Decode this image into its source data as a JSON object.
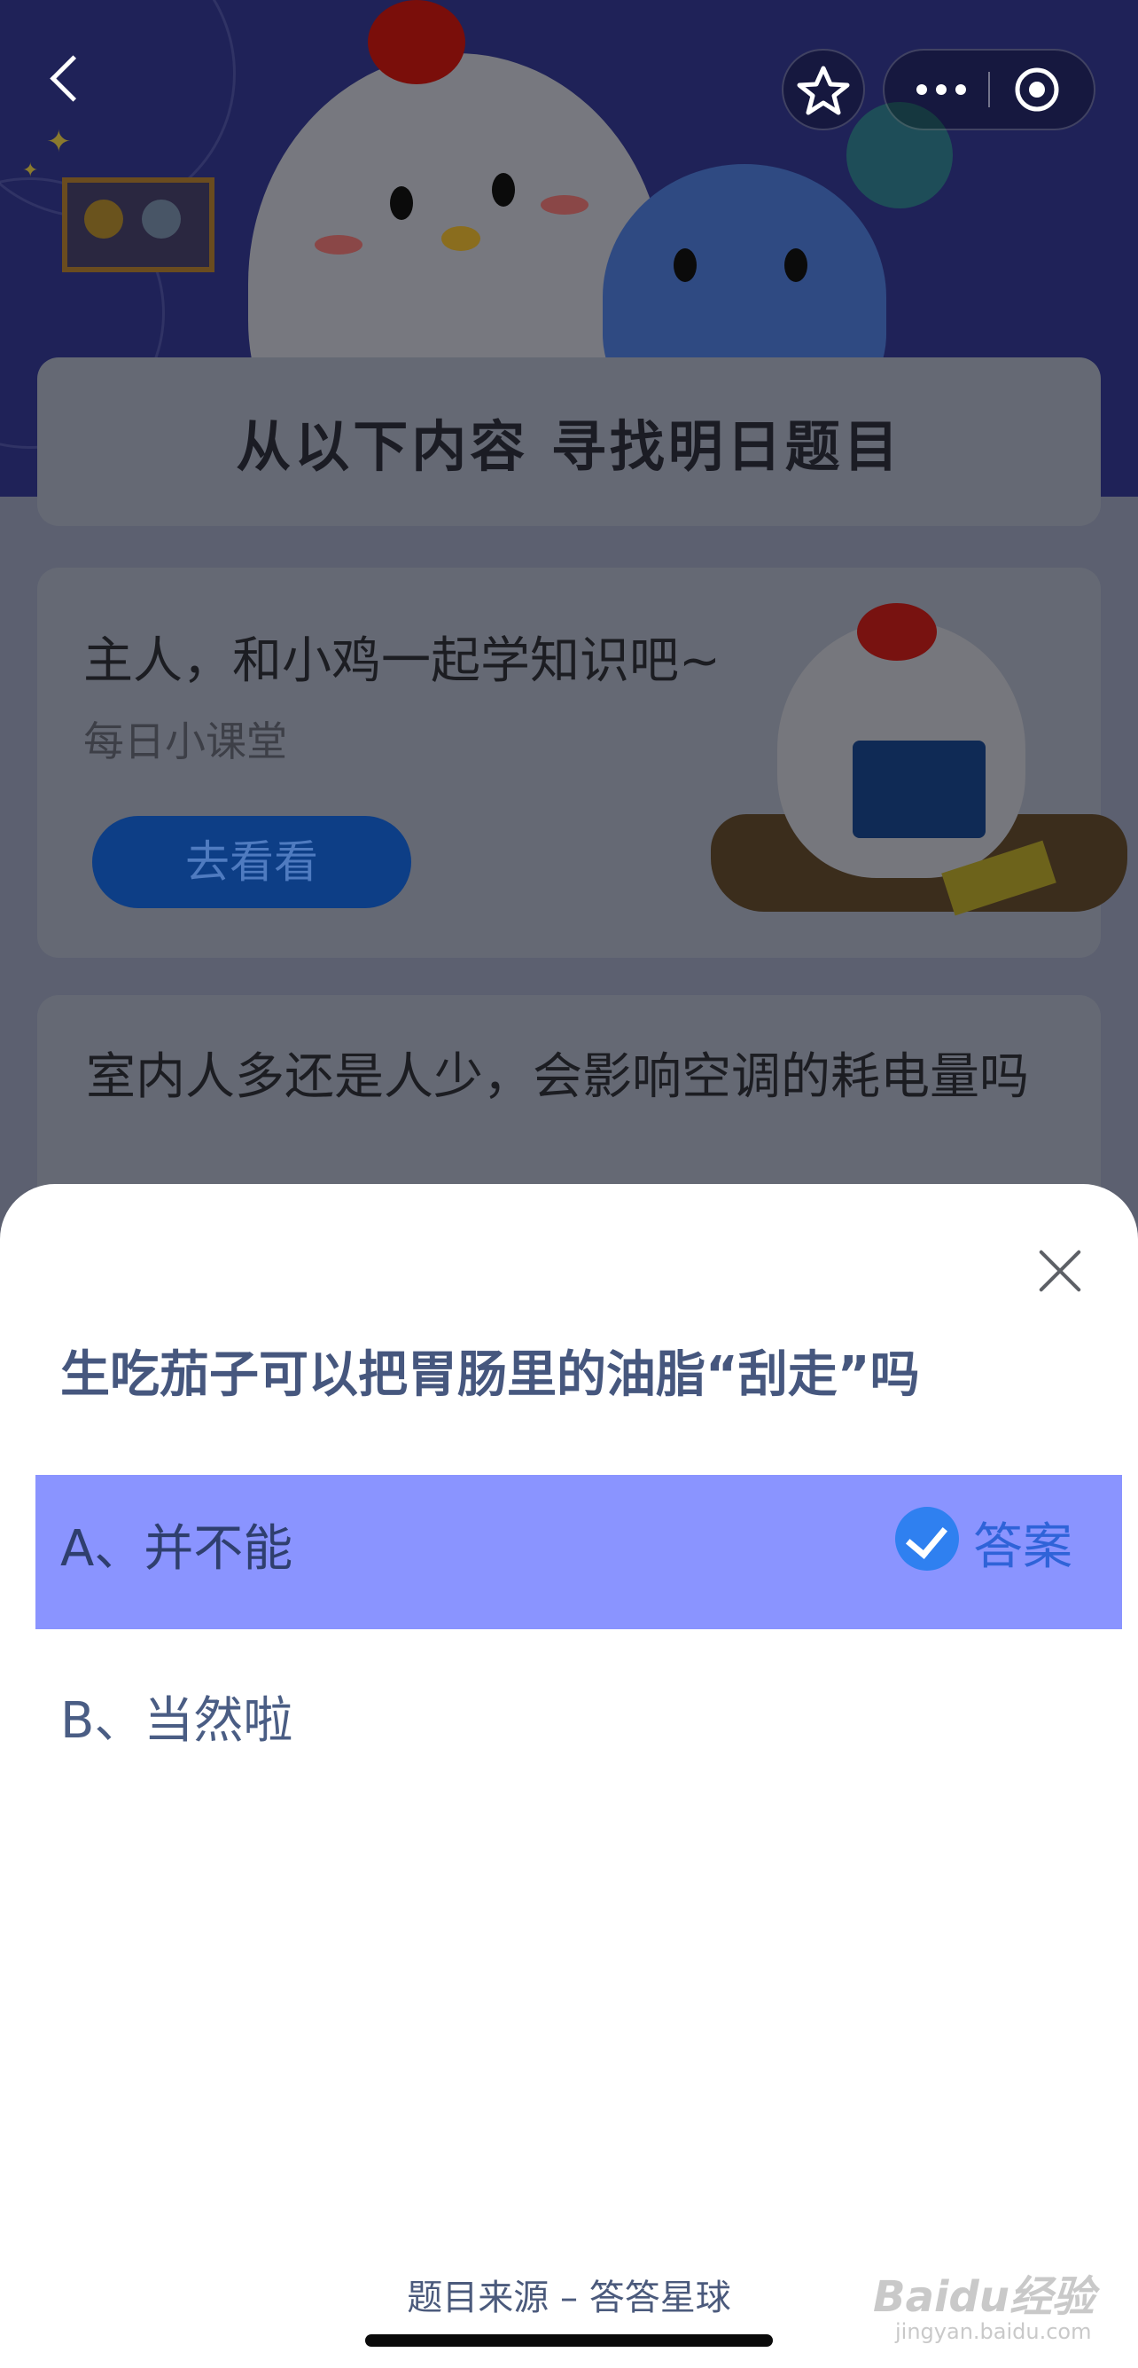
{
  "banner": {
    "title": "从以下内容 寻找明日题目"
  },
  "lesson_card": {
    "title": "主人，和小鸡一起学知识吧~",
    "subtitle": "每日小课堂",
    "button_label": "去看看"
  },
  "question_card": {
    "text": "室内人多还是人少，会影响空调的耗电量吗"
  },
  "sheet": {
    "question": "生吃茄子可以把胃肠里的油脂“刮走”吗",
    "options": [
      {
        "label": "A、并不能",
        "is_answer": true,
        "answer_tag": "答案"
      },
      {
        "label": "B、当然啦",
        "is_answer": false
      }
    ],
    "source": "题目来源 – 答答星球"
  },
  "watermark": {
    "brand": "Baidu经验",
    "url": "jingyan.baidu.com"
  },
  "colors": {
    "answer_highlight": "#8a94ff",
    "check": "#2f80f0",
    "question_text": "#46577e"
  },
  "icons": [
    "back-icon",
    "star-icon",
    "more-icon",
    "record-icon",
    "close-icon",
    "check-icon"
  ]
}
